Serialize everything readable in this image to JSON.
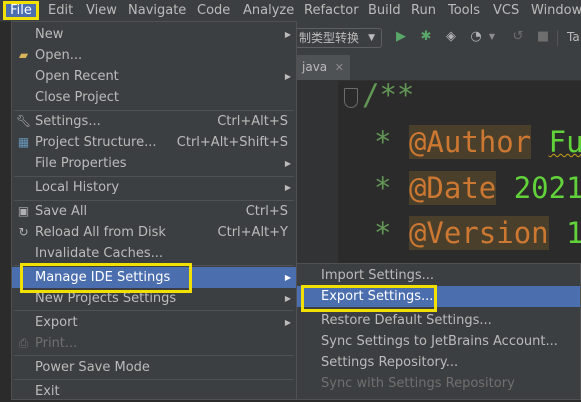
{
  "menubar": {
    "items": [
      "File",
      "Edit",
      "View",
      "Navigate",
      "Code",
      "Analyze",
      "Refactor",
      "Build",
      "Run",
      "Tools",
      "VCS",
      "Window"
    ]
  },
  "toolbar": {
    "config_label": "制类型转换",
    "partial_label": "Ta"
  },
  "tab": {
    "label": "java"
  },
  "editor": {
    "line1": "/**",
    "line2_tag": "@Author",
    "line2_val": "Fu",
    "line3_tag": "@Date",
    "line3_val": "2021",
    "line4_tag": "@Version",
    "line4_val": "1"
  },
  "file_menu": {
    "new": "New",
    "open": "Open...",
    "open_recent": "Open Recent",
    "close_project": "Close Project",
    "settings": "Settings...",
    "settings_sc": "Ctrl+Alt+S",
    "project_structure": "Project Structure...",
    "project_structure_sc": "Ctrl+Alt+Shift+S",
    "file_properties": "File Properties",
    "local_history": "Local History",
    "save_all": "Save All",
    "save_all_sc": "Ctrl+S",
    "reload": "Reload All from Disk",
    "reload_sc": "Ctrl+Alt+Y",
    "invalidate": "Invalidate Caches...",
    "manage_ide": "Manage IDE Settings",
    "new_projects_settings": "New Projects Settings",
    "export": "Export",
    "print": "Print...",
    "power_save": "Power Save Mode",
    "exit": "Exit"
  },
  "submenu": {
    "import": "Import Settings...",
    "export": "Export Settings...",
    "restore": "Restore Default Settings...",
    "sync": "Sync Settings to JetBrains Account...",
    "repository": "Settings Repository...",
    "sync_repo": "Sync with Settings Repository"
  },
  "colors": {
    "selection": "#4b6eaf",
    "highlight_box": "#f2e100",
    "menu_bg": "#3c3f41"
  }
}
